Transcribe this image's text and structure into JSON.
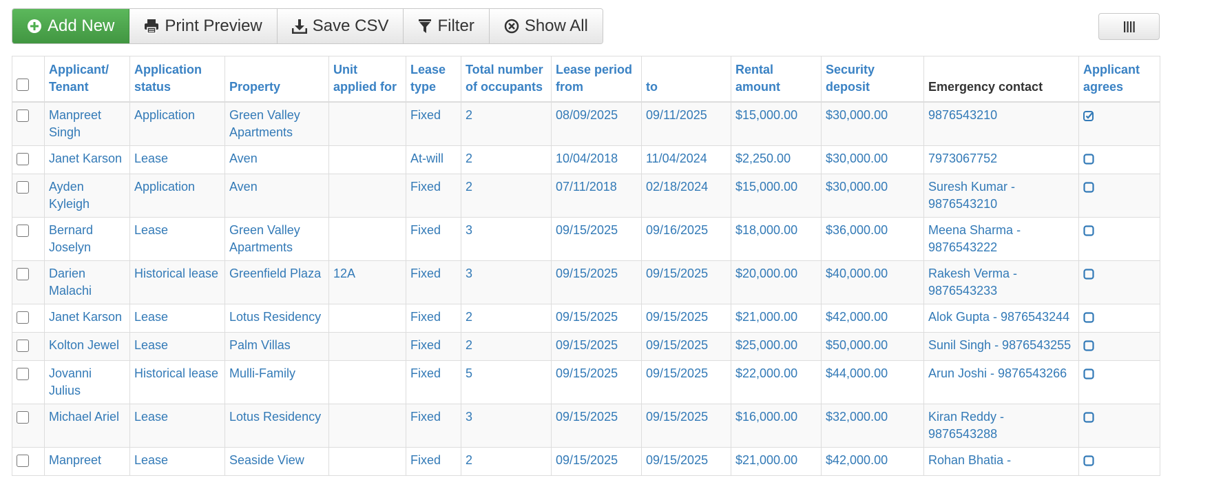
{
  "toolbar": {
    "add_new": "Add New",
    "print_preview": "Print Preview",
    "save_csv": "Save CSV",
    "filter": "Filter",
    "show_all": "Show All"
  },
  "table": {
    "headers": {
      "applicant": "Applicant/ Tenant",
      "status": "Application status",
      "property": "Property",
      "unit": "Unit applied for",
      "lease_type": "Lease type",
      "occupants": "Total number of occupants",
      "from": "Lease period from",
      "to": "to",
      "rent": "Rental amount",
      "deposit": "Security deposit",
      "contact": "Emergency contact",
      "agrees": "Applicant agrees"
    },
    "rows": [
      {
        "applicant": "Manpreet Singh",
        "status": "Application",
        "property": "Green Valley Apartments",
        "unit": "",
        "lease_type": "Fixed",
        "occupants": "2",
        "from": "08/09/2025",
        "to": "09/11/2025",
        "rent": "$15,000.00",
        "deposit": "$30,000.00",
        "contact": "9876543210",
        "agrees": true
      },
      {
        "applicant": "Janet Karson",
        "status": "Lease",
        "property": "Aven",
        "unit": "",
        "lease_type": "At-will",
        "occupants": "2",
        "from": "10/04/2018",
        "to": "11/04/2024",
        "rent": "$2,250.00",
        "deposit": "$30,000.00",
        "contact": "7973067752",
        "agrees": false
      },
      {
        "applicant": "Ayden Kyleigh",
        "status": "Application",
        "property": "Aven",
        "unit": "",
        "lease_type": "Fixed",
        "occupants": "2",
        "from": "07/11/2018",
        "to": "02/18/2024",
        "rent": "$15,000.00",
        "deposit": "$30,000.00",
        "contact": "Suresh Kumar - 9876543210",
        "agrees": false
      },
      {
        "applicant": "Bernard Joselyn",
        "status": "Lease",
        "property": "Green Valley Apartments",
        "unit": "",
        "lease_type": "Fixed",
        "occupants": "3",
        "from": "09/15/2025",
        "to": "09/16/2025",
        "rent": "$18,000.00",
        "deposit": "$36,000.00",
        "contact": "Meena Sharma - 9876543222",
        "agrees": false
      },
      {
        "applicant": "Darien Malachi",
        "status": "Historical lease",
        "property": "Greenfield Plaza",
        "unit": "12A",
        "lease_type": "Fixed",
        "occupants": "3",
        "from": "09/15/2025",
        "to": "09/15/2025",
        "rent": "$20,000.00",
        "deposit": "$40,000.00",
        "contact": "Rakesh Verma - 9876543233",
        "agrees": false
      },
      {
        "applicant": "Janet Karson",
        "status": "Lease",
        "property": "Lotus Residency",
        "unit": "",
        "lease_type": "Fixed",
        "occupants": "2",
        "from": "09/15/2025",
        "to": "09/15/2025",
        "rent": "$21,000.00",
        "deposit": "$42,000.00",
        "contact": "Alok Gupta - 9876543244",
        "agrees": false
      },
      {
        "applicant": "Kolton Jewel",
        "status": "Lease",
        "property": "Palm Villas",
        "unit": "",
        "lease_type": "Fixed",
        "occupants": "2",
        "from": "09/15/2025",
        "to": "09/15/2025",
        "rent": "$25,000.00",
        "deposit": "$50,000.00",
        "contact": "Sunil Singh - 9876543255",
        "agrees": false
      },
      {
        "applicant": "Jovanni Julius",
        "status": "Historical lease",
        "property": "Mulli-Family",
        "unit": "",
        "lease_type": "Fixed",
        "occupants": "5",
        "from": "09/15/2025",
        "to": "09/15/2025",
        "rent": "$22,000.00",
        "deposit": "$44,000.00",
        "contact": "Arun Joshi - 9876543266",
        "agrees": false
      },
      {
        "applicant": "Michael Ariel",
        "status": "Lease",
        "property": "Lotus Residency",
        "unit": "",
        "lease_type": "Fixed",
        "occupants": "3",
        "from": "09/15/2025",
        "to": "09/15/2025",
        "rent": "$16,000.00",
        "deposit": "$32,000.00",
        "contact": "Kiran Reddy - 9876543288",
        "agrees": false
      },
      {
        "applicant": "Manpreet",
        "status": "Lease",
        "property": "Seaside View",
        "unit": "",
        "lease_type": "Fixed",
        "occupants": "2",
        "from": "09/15/2025",
        "to": "09/15/2025",
        "rent": "$21,000.00",
        "deposit": "$42,000.00",
        "contact": "Rohan Bhatia -",
        "agrees": false
      }
    ]
  }
}
